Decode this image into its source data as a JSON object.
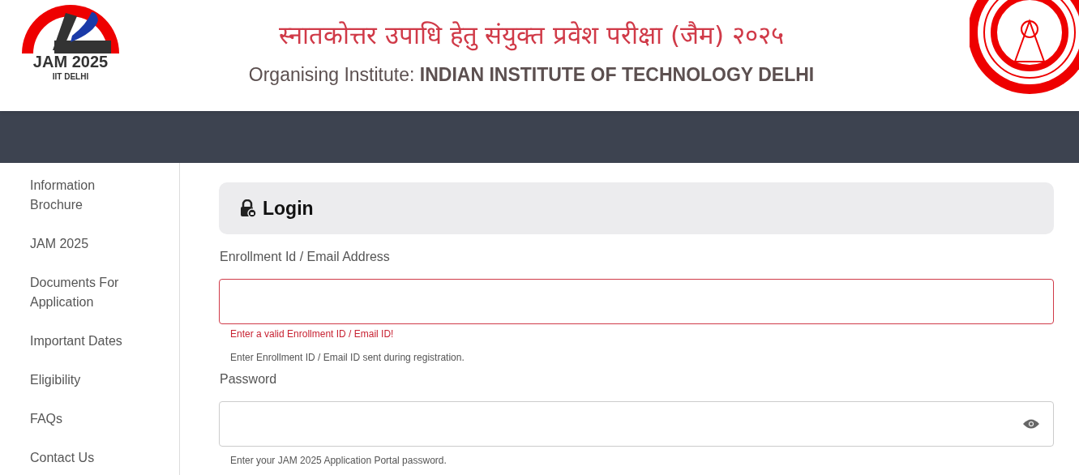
{
  "header": {
    "logo_title": "JAM 2025",
    "logo_subtitle": "IIT DELHI",
    "hindi_title": "स्नातकोत्तर उपाधि हेतु संयुक्त प्रवेश परीक्षा (जैम) २०२५",
    "organiser_label": "Organising Institute:",
    "organiser_name": "INDIAN INSTITUTE OF TECHNOLOGY DELHI"
  },
  "sidebar": {
    "items": [
      {
        "label": "Information Brochure"
      },
      {
        "label": "JAM 2025"
      },
      {
        "label": "Documents For Application"
      },
      {
        "label": "Important Dates"
      },
      {
        "label": "Eligibility"
      },
      {
        "label": "FAQs"
      },
      {
        "label": "Contact Us"
      }
    ]
  },
  "login": {
    "title": "Login",
    "fields": [
      {
        "label": "Enrollment Id / Email Address",
        "kind": "text",
        "invalid": true,
        "error": "Enter a valid Enrollment ID / Email ID!",
        "help": "Enter Enrollment ID / Email ID sent during registration."
      },
      {
        "label": "Password",
        "kind": "password",
        "invalid": false,
        "help": "Enter your JAM 2025 Application Portal password."
      }
    ]
  }
}
